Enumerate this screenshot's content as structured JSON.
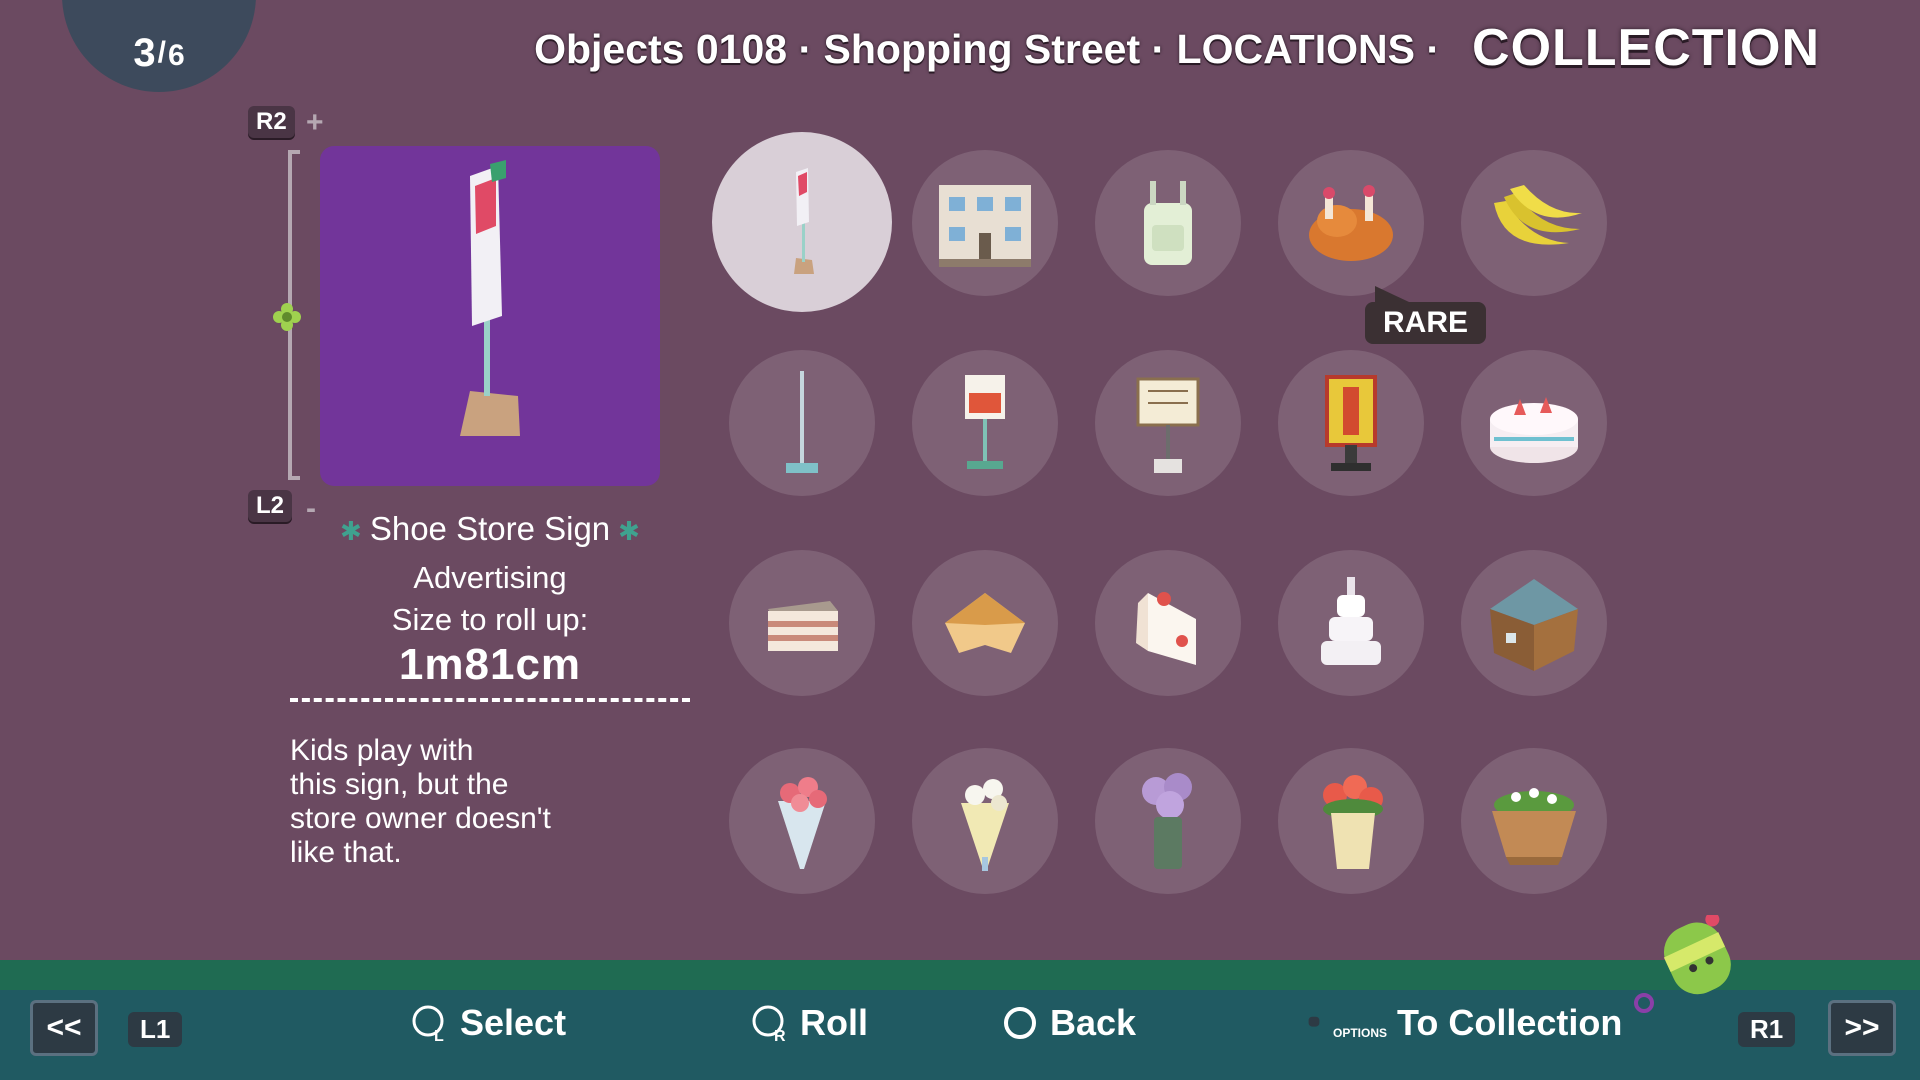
{
  "page_counter": {
    "current": "3",
    "separator": "/",
    "total": "6"
  },
  "header": {
    "breadcrumb": "Objects 0108 · Shopping Street · LOCATIONS ·",
    "title": "COLLECTION"
  },
  "zoom": {
    "zoom_in_button": "R2",
    "zoom_in_symbol": "+",
    "zoom_out_button": "L2",
    "zoom_out_symbol": "-"
  },
  "item": {
    "name": "Shoe Store Sign",
    "category": "Advertising",
    "size_label": "Size to roll up:",
    "size_value": "1m81cm",
    "description": "Kids play with\nthis sign, but the\nstore owner doesn't\nlike that."
  },
  "grid": {
    "items": [
      {
        "icon": "shoe-store-sign-icon"
      },
      {
        "icon": "building-icon"
      },
      {
        "icon": "backpack-icon"
      },
      {
        "icon": "roast-chicken-icon",
        "badge": "RARE"
      },
      {
        "icon": "banana-icon"
      },
      {
        "icon": "pole-icon"
      },
      {
        "icon": "sale-sign-icon"
      },
      {
        "icon": "menu-board-icon"
      },
      {
        "icon": "restaurant-sign-icon"
      },
      {
        "icon": "cake-icon"
      },
      {
        "icon": "layer-cake-slice-icon"
      },
      {
        "icon": "cheesecake-icon"
      },
      {
        "icon": "shortcake-slice-icon"
      },
      {
        "icon": "wedding-cake-icon"
      },
      {
        "icon": "house-icon"
      },
      {
        "icon": "rose-bouquet-icon"
      },
      {
        "icon": "lily-bouquet-icon"
      },
      {
        "icon": "hydrangea-vase-icon"
      },
      {
        "icon": "flower-pot-icon"
      },
      {
        "icon": "planter-icon"
      }
    ]
  },
  "bottom_bar": {
    "prev_button": "<<",
    "prev_shoulder": "L1",
    "select_label": "Select",
    "roll_label": "Roll",
    "back_label": "Back",
    "options_label": "OPTIONS",
    "collection_label": "To Collection",
    "next_shoulder": "R1",
    "next_button": ">>"
  },
  "colors": {
    "background": "#6b4a61",
    "preview_bg": "#72359a",
    "bottom_bar": "#205a62",
    "rare_badge": "#3b3033"
  }
}
